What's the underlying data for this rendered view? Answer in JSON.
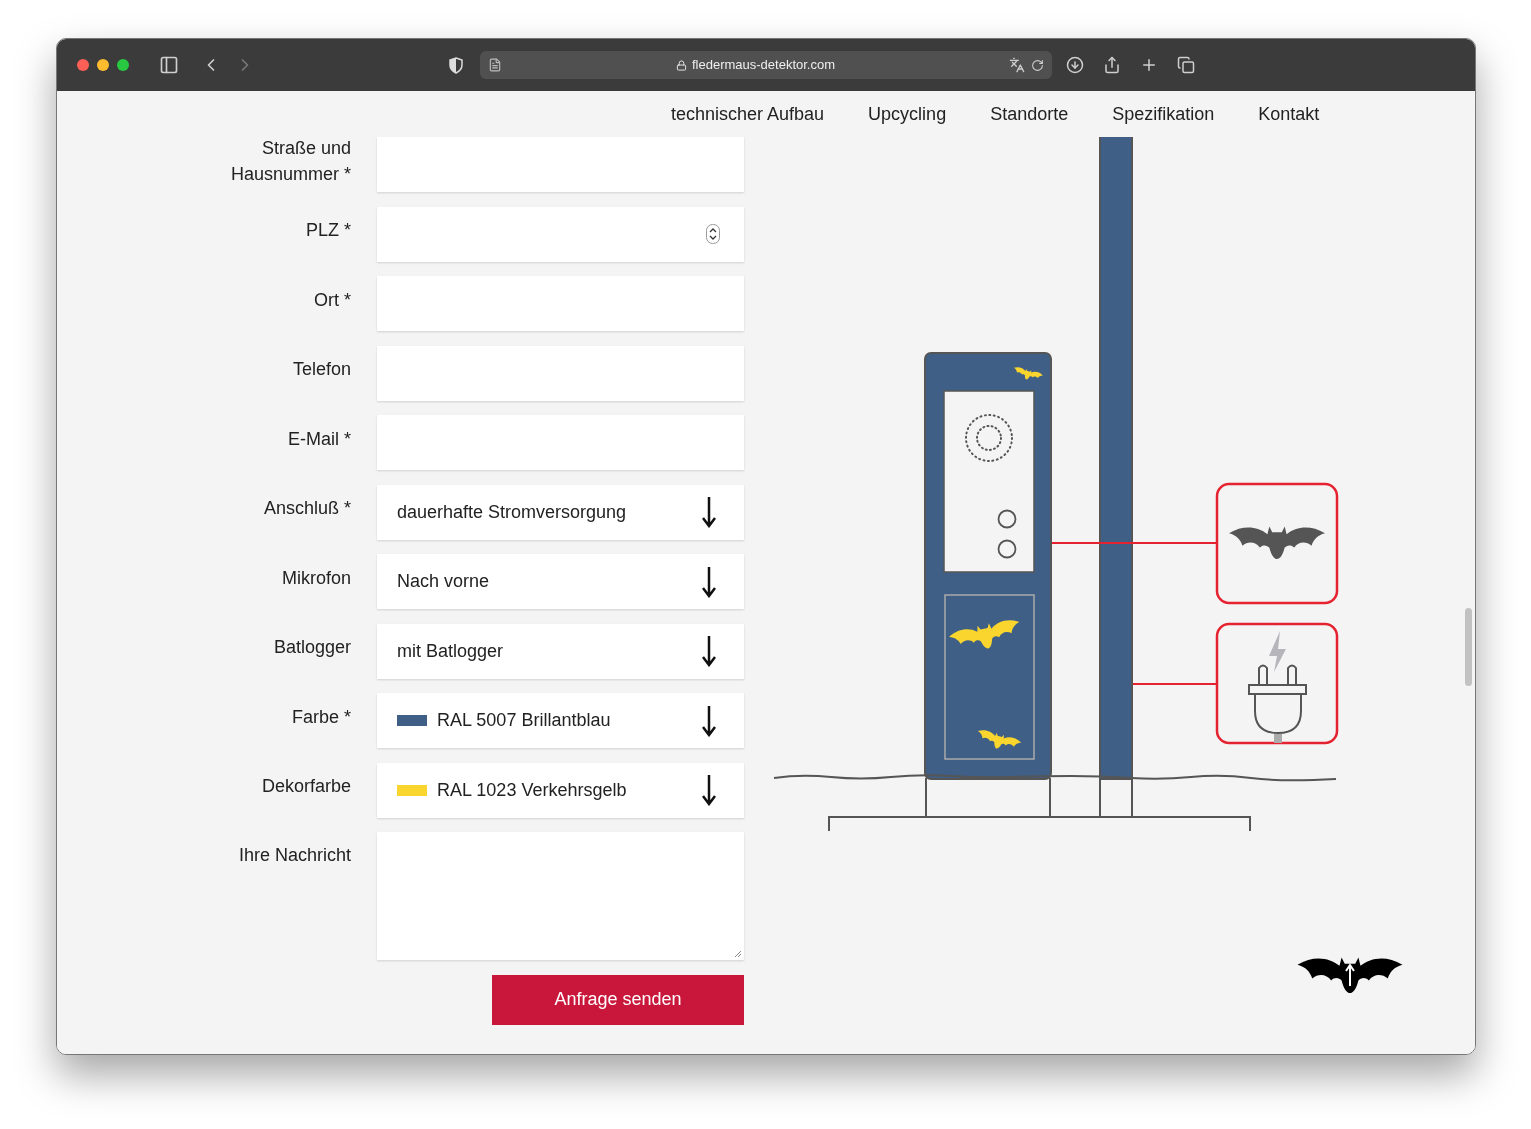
{
  "browser": {
    "url": "fledermaus-detektor.com"
  },
  "nav": [
    {
      "label": "technischer Aufbau"
    },
    {
      "label": "Upcycling"
    },
    {
      "label": "Standorte"
    },
    {
      "label": "Spezifikation"
    },
    {
      "label": "Kontakt"
    }
  ],
  "form": {
    "fields": [
      {
        "kind": "text",
        "label": "Straße und Hausnummer *"
      },
      {
        "kind": "number",
        "label": "PLZ *"
      },
      {
        "kind": "text",
        "label": "Ort *"
      },
      {
        "kind": "text",
        "label": "Telefon"
      },
      {
        "kind": "text",
        "label": "E-Mail *"
      },
      {
        "kind": "select",
        "label": "Anschluß *",
        "value": "dauerhafte Stromversorgung"
      },
      {
        "kind": "select",
        "label": "Mikrofon",
        "value": "Nach vorne"
      },
      {
        "kind": "select",
        "label": "Batlogger",
        "value": "mit Batlogger"
      },
      {
        "kind": "select",
        "label": "Farbe *",
        "value": "RAL 5007 Brillantblau",
        "color": "#3f5f87"
      },
      {
        "kind": "select",
        "label": "Dekorfarbe",
        "value": "RAL 1023 Verkehrsgelb",
        "color": "#f9d52e"
      },
      {
        "kind": "textarea",
        "label": "Ihre Nachricht"
      }
    ],
    "submit": "Anfrage senden"
  }
}
